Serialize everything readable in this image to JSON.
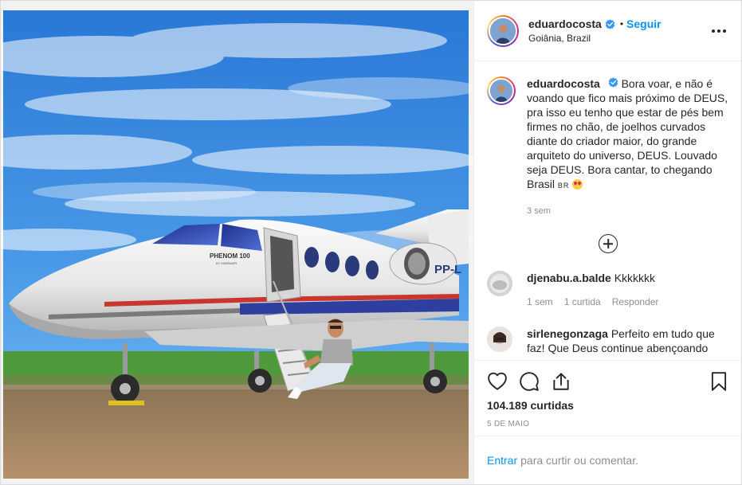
{
  "post": {
    "image_alt": "Man sitting on the steps of a Phenom 100 jet parked on a runway",
    "aircraft_text": {
      "model": "PHENOM 100",
      "maker": "BY EMBRAER",
      "registration": "PP-L"
    }
  },
  "header": {
    "username": "eduardocosta",
    "verified": true,
    "separator": "•",
    "follow_label": "Seguir",
    "location": "Goiânia, Brazil",
    "more_icon": "more-options-icon"
  },
  "caption": {
    "username": "eduardocosta",
    "text": "Bora voar, e não é voando que fico mais próximo de DEUS, pra isso eu tenho que estar de pés bem firmes no chão, de joelhos curvados diante do criador maior, do grande arquiteto do universo, DEUS. Louvado seja DEUS. Bora cantar, to chegando Brasil",
    "flag": "BR",
    "emoji": "smiling-face-with-heart-eyes",
    "time": "3 sem"
  },
  "load_more_icon": "plus-circle-icon",
  "comments": [
    {
      "username": "djenabu.a.balde",
      "text": "Kkkkkkk",
      "time": "1 sem",
      "likes": "1 curtida",
      "reply": "Responder"
    },
    {
      "username": "sirlenegonzaga",
      "text": "Perfeito em tudo que faz! Que Deus continue abençoando",
      "time": "",
      "likes": "",
      "reply": ""
    }
  ],
  "actions": {
    "icons": [
      "heart-icon",
      "comment-icon",
      "share-icon",
      "bookmark-icon"
    ],
    "likes": "104.189 curtidas",
    "date": "5 DE MAIO"
  },
  "login": {
    "link": "Entrar",
    "text": "para curtir ou comentar."
  },
  "colors": {
    "accent": "#0095f6",
    "text": "#262626",
    "muted": "#8e8e8e",
    "border": "#dbdbdb"
  }
}
